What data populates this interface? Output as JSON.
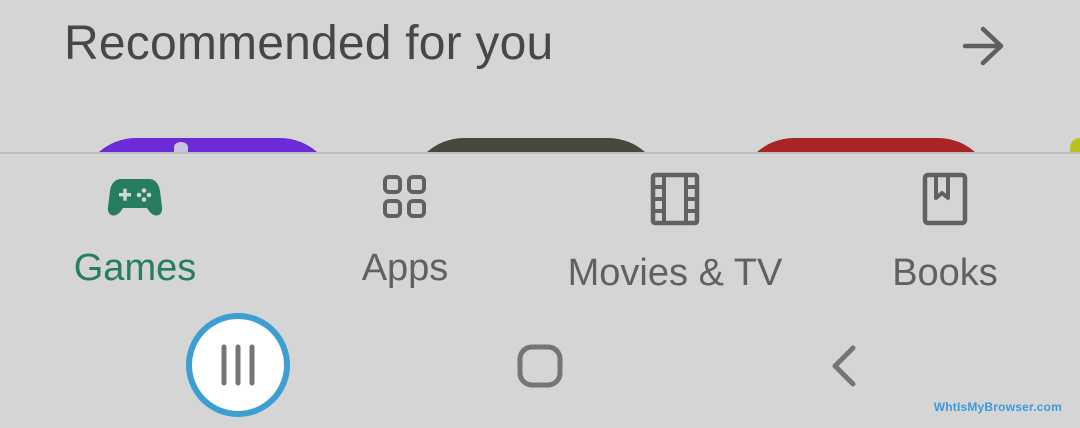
{
  "section": {
    "title": "Recommended for you",
    "more_icon": "arrow-right-icon"
  },
  "cards": [
    {
      "color": "#6c2bd6"
    },
    {
      "color": "#4a4741"
    },
    {
      "color": "#a92424"
    },
    {
      "color": "#b7c21c"
    }
  ],
  "bottom_nav": {
    "items": [
      {
        "label": "Games",
        "icon": "gamepad-icon",
        "selected": true,
        "color": "#267d62"
      },
      {
        "label": "Apps",
        "icon": "apps-grid-icon",
        "selected": false,
        "color": "#616161"
      },
      {
        "label": "Movies & TV",
        "icon": "film-icon",
        "selected": false,
        "color": "#616161"
      },
      {
        "label": "Books",
        "icon": "book-icon",
        "selected": false,
        "color": "#616161"
      }
    ]
  },
  "system_nav": {
    "recent_icon": "recent-apps-icon",
    "home_icon": "home-icon",
    "back_icon": "back-icon",
    "highlight_color": "#3d9fd1"
  },
  "watermark": "WhtIsMyBrowser.com"
}
